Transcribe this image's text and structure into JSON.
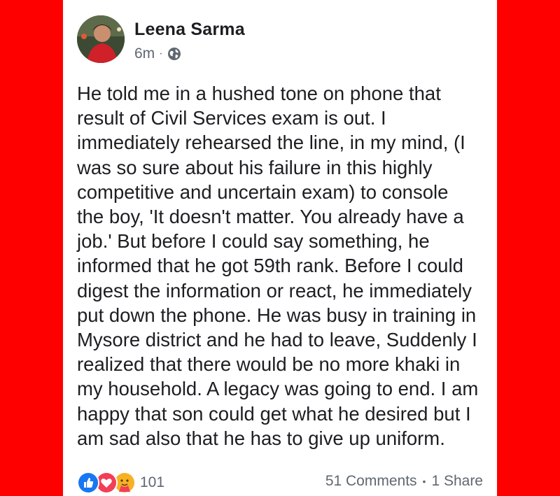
{
  "post": {
    "author": "Leena Sarma",
    "time": "6m",
    "separator": "·",
    "privacy_icon": "globe-icon",
    "text": "He told me in a hushed tone on phone that\nresult of Civil Services exam is out. I\nimmediately rehearsed  the line, in my mind, (I\nwas so sure about his failure in this highly\ncompetitive and uncertain exam) to console\nthe boy, 'It doesn't matter. You already have a\njob.' But before I could say something,  he\ninformed that he got 59th rank. Before I could\ndigest the information or react, he  immediately\nput down the phone. He was busy in training in\nMysore district and he had to leave, Suddenly I\nrealized that there would be no more khaki in\nmy household. A legacy was going to end. I am\nhappy that son could get what he desired but I\nam sad also that he has to give up uniform."
  },
  "footer": {
    "reaction_icons": [
      "like-icon",
      "love-icon",
      "care-icon"
    ],
    "reaction_count": "101",
    "comments": "51 Comments",
    "separator": "•",
    "shares": "1 Share"
  },
  "colors": {
    "background": "#ff0000",
    "card": "#ffffff",
    "like": "#1877f2",
    "love": "#f33e58",
    "care": "#f7b125"
  }
}
